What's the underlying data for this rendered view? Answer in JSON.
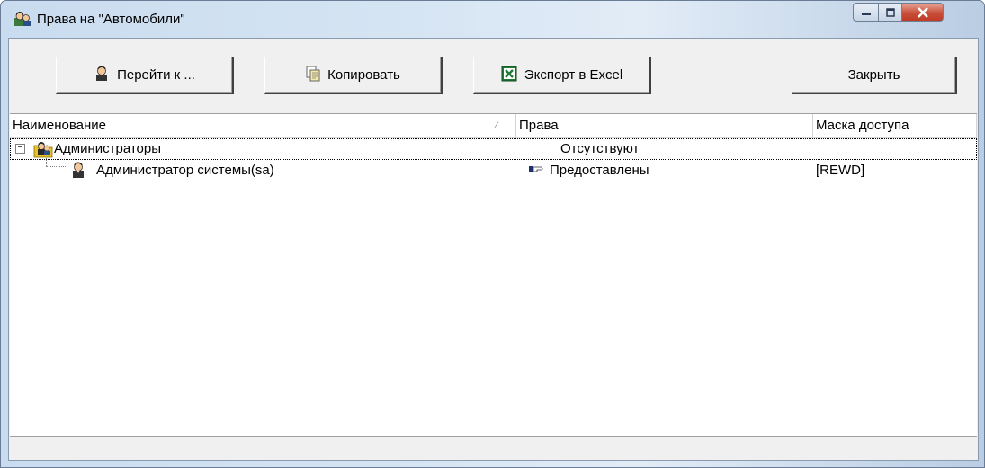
{
  "window": {
    "title": "Права на \"Автомобили\""
  },
  "toolbar": {
    "goto_label": "Перейти к ...",
    "copy_label": "Копировать",
    "export_label": "Экспорт в Excel",
    "close_label": "Закрыть"
  },
  "table": {
    "columns": [
      "Наименование",
      "Права",
      "Маска доступа"
    ],
    "rows": [
      {
        "name": "Администраторы",
        "rights": "Отсутствуют",
        "mask": ""
      },
      {
        "name": "Администратор системы(sa)",
        "rights": "Предоставлены",
        "mask": "[REWD]"
      }
    ]
  },
  "icons": {
    "title": "users-icon",
    "goto": "user-icon",
    "copy": "copy-document-icon",
    "export": "excel-icon",
    "group": "user-group-icon",
    "user": "user-icon",
    "granted": "hand-pointing-icon"
  },
  "colors": {
    "title_gradient_start": "#c9dcef",
    "close_button": "#c74f3a",
    "excel_green": "#1f7a35",
    "folder_yellow": "#e6c229"
  }
}
